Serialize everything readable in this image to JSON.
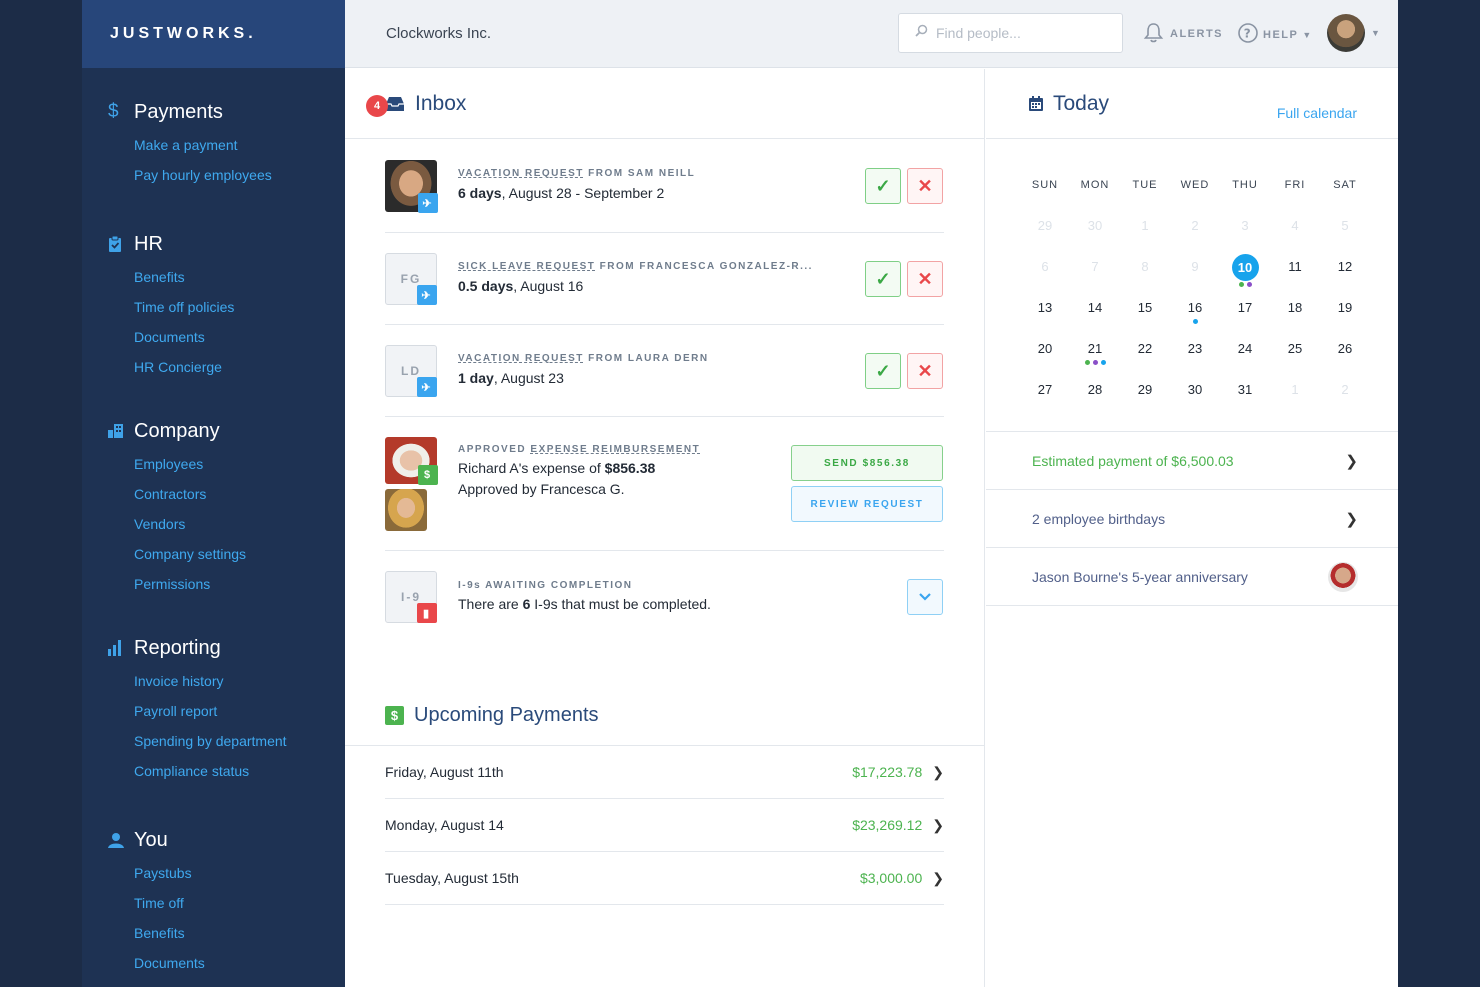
{
  "brand": {
    "logo": "JUSTWORKS."
  },
  "sidebar": {
    "sections": [
      {
        "title": "Payments",
        "icon": "dollar-icon",
        "items": [
          "Make a payment",
          "Pay hourly employees"
        ]
      },
      {
        "title": "HR",
        "icon": "clipboard-icon",
        "items": [
          "Benefits",
          "Time off policies",
          "Documents",
          "HR Concierge"
        ]
      },
      {
        "title": "Company",
        "icon": "building-icon",
        "items": [
          "Employees",
          "Contractors",
          "Vendors",
          "Company settings",
          "Permissions"
        ]
      },
      {
        "title": "Reporting",
        "icon": "bar-chart-icon",
        "items": [
          "Invoice history",
          "Payroll report",
          "Spending by department",
          "Compliance status"
        ]
      },
      {
        "title": "You",
        "icon": "person-icon",
        "items": [
          "Paystubs",
          "Time off",
          "Benefits",
          "Documents"
        ]
      }
    ]
  },
  "topbar": {
    "company": "Clockworks Inc.",
    "search_placeholder": "Find people...",
    "alerts": "ALERTS",
    "help": "HELP"
  },
  "inbox": {
    "title": "Inbox",
    "badge": "4",
    "requests": [
      {
        "initials": "",
        "type": "VACATION REQUEST",
        "from": " FROM SAM NEILL",
        "amount": "6 days",
        "detail": ", August 28 - September 2"
      },
      {
        "initials": "FG",
        "type": "SICK LEAVE REQUEST",
        "from": " FROM FRANCESCA GONZALEZ-R...",
        "amount": "0.5 days",
        "detail": ", August 16"
      },
      {
        "initials": "LD",
        "type": "VACATION REQUEST",
        "from": " FROM LAURA DERN",
        "amount": "1 day",
        "detail": ", August 23"
      }
    ],
    "expense": {
      "prefix": "APPROVED ",
      "type": "EXPENSE REIMBURSEMENT",
      "line1_pre": "Richard A's expense of ",
      "line1_amount": "$856.38",
      "line2": "Approved by Francesca G.",
      "send_label": "SEND $856.38",
      "review_label": "REVIEW REQUEST"
    },
    "i9": {
      "initials": "I-9",
      "title": "I-9s AWAITING COMPLETION",
      "pre": "There are ",
      "count": "6",
      "post": " I-9s that must be completed."
    }
  },
  "upcoming": {
    "title": "Upcoming Payments",
    "payments": [
      {
        "date": "Friday, August 11th",
        "amount": "$17,223.78"
      },
      {
        "date": "Monday, August 14",
        "amount": "$23,269.12"
      },
      {
        "date": "Tuesday, August 15th",
        "amount": "$3,000.00"
      }
    ]
  },
  "today": {
    "title": "Today",
    "full_calendar": "Full calendar",
    "weekdays": [
      "SUN",
      "MON",
      "TUE",
      "WED",
      "THU",
      "FRI",
      "SAT"
    ],
    "weeks": [
      [
        {
          "d": "29",
          "dim": true
        },
        {
          "d": "30",
          "dim": true
        },
        {
          "d": "1",
          "dim": true
        },
        {
          "d": "2",
          "dim": true
        },
        {
          "d": "3",
          "dim": true
        },
        {
          "d": "4",
          "dim": true
        },
        {
          "d": "5",
          "dim": true
        }
      ],
      [
        {
          "d": "6",
          "dim": true
        },
        {
          "d": "7",
          "dim": true
        },
        {
          "d": "8",
          "dim": true
        },
        {
          "d": "9",
          "dim": true
        },
        {
          "d": "10",
          "today": true,
          "dots": [
            "#4cb34f",
            "#8a4fc8"
          ]
        },
        {
          "d": "11"
        },
        {
          "d": "12"
        }
      ],
      [
        {
          "d": "13"
        },
        {
          "d": "14"
        },
        {
          "d": "15"
        },
        {
          "d": "16",
          "dots": [
            "#17a3ec"
          ]
        },
        {
          "d": "17"
        },
        {
          "d": "18"
        },
        {
          "d": "19"
        }
      ],
      [
        {
          "d": "20"
        },
        {
          "d": "21",
          "dots": [
            "#4cb34f",
            "#8a4fc8",
            "#17a3ec"
          ]
        },
        {
          "d": "22"
        },
        {
          "d": "23"
        },
        {
          "d": "24"
        },
        {
          "d": "25"
        },
        {
          "d": "26"
        }
      ],
      [
        {
          "d": "27"
        },
        {
          "d": "28"
        },
        {
          "d": "29"
        },
        {
          "d": "30"
        },
        {
          "d": "31"
        },
        {
          "d": "1",
          "dim": true
        },
        {
          "d": "2",
          "dim": true
        }
      ]
    ],
    "events": [
      {
        "text": "Estimated payment of $6,500.03",
        "color": "#4cb34f"
      },
      {
        "text": "2 employee birthdays",
        "color": "#52608a"
      },
      {
        "text": "Jason Bourne's 5-year anniversary",
        "color": "#52608a"
      }
    ]
  },
  "colors": {
    "accent": "#3aa5ef",
    "green": "#4cb34f",
    "red": "#e9474a",
    "today": "#17a3ec",
    "sidebar_bg": "#1e3253",
    "logo_bg": "#27467a"
  }
}
